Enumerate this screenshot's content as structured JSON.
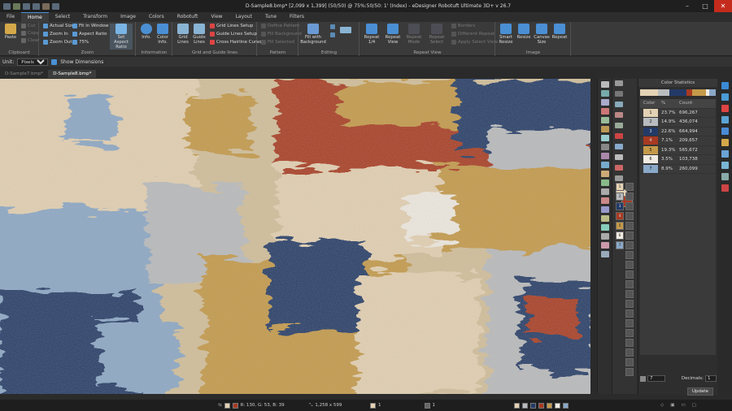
{
  "window": {
    "title": "D-Sample8.bmp* [2,099 x 1,399] (50/50) @ 75%:50/50: 1' (Index) - eDesigner Robotuft Ultimate 3D+ v 26.7",
    "min": "–",
    "max": "□",
    "close": "✕"
  },
  "menu": [
    "File",
    "Home",
    "Select",
    "Transform",
    "Image",
    "Colors",
    "Robotuft",
    "View",
    "Layout",
    "Tune",
    "Filters"
  ],
  "ribbon": {
    "clipboard": {
      "label": "Clipboard",
      "paste": "Paste",
      "cut": "Cut",
      "copy": "Copy",
      "clear": "Clear"
    },
    "zoom": {
      "label": "Zoom",
      "actual": "Actual Size",
      "zin": "Zoom In",
      "zout": "Zoom Out",
      "fit": "Fit in Window",
      "aspect": "Aspect Ratio",
      "pct": "75%",
      "set_aspect": "Set Aspect Ratio"
    },
    "information": {
      "label": "Information",
      "info": "Info.",
      "color_info": "Color Info."
    },
    "grid": {
      "label": "Grid and Guide lines",
      "grid_lines": "Grid Lines",
      "guide_lines": "Guide Lines",
      "grid_setup": "Grid Lines Setup",
      "guide_setup": "Guide Lines Setup",
      "cross": "Cross Hairline Cursor"
    },
    "pattern": {
      "label": "Pattern",
      "define": "Define Pattern",
      "fill_bg": "Fill Background",
      "fill_sel": "Fill Selected"
    },
    "editing": {
      "label": "Editing",
      "fill_with_bg": "Fill with Background"
    },
    "repeat_view": {
      "label": "Repeat View",
      "repeat14": "Repeat 1/4",
      "repeat_view": "Repeat View",
      "repeat_mode": "Repeat Mode",
      "repeat_select": "Repeat Select",
      "borders": "Borders",
      "diff_repeat": "Different Repeat",
      "apply_sel": "Apply Select View"
    },
    "image": {
      "label": "Image",
      "smart_resize": "Smart Resize",
      "resize": "Resize",
      "canvas": "Canvas Size",
      "repeat": "Repeat"
    }
  },
  "options": {
    "unit_label": "Unit:",
    "unit_value": "Pixels",
    "show_dimensions": "Show Dimensions"
  },
  "tabs": [
    "D-Sample7.bmp*",
    "D-Sample8.bmp*"
  ],
  "colors": {
    "c1": "#e4d2b4",
    "c2": "#b9bcbf",
    "c3": "#233a68",
    "c4": "#a83a22",
    "c5": "#c49a4a",
    "c6": "#f0ece4",
    "c7": "#8aa8c8"
  },
  "panel": {
    "title": "Color Statistics",
    "headers": [
      "Color",
      "%",
      "Count"
    ],
    "rows": [
      {
        "n": "1",
        "pct": "23.7%",
        "count": "696,267",
        "color": "#e4d2b4"
      },
      {
        "n": "2",
        "pct": "14.9%",
        "count": "436,074",
        "color": "#b9bcbf"
      },
      {
        "n": "3",
        "pct": "22.6%",
        "count": "664,994",
        "color": "#233a68"
      },
      {
        "n": "4",
        "pct": "7.1%",
        "count": "209,657",
        "color": "#a83a22"
      },
      {
        "n": "5",
        "pct": "19.3%",
        "count": "565,672",
        "color": "#c49a4a"
      },
      {
        "n": "6",
        "pct": "3.5%",
        "count": "103,738",
        "color": "#f0ece4"
      },
      {
        "n": "7",
        "pct": "8.9%",
        "count": "260,099",
        "color": "#8aa8c8"
      }
    ],
    "count_value": "7",
    "decimals_label": "Decimals:",
    "decimals_value": "1",
    "update": "Update"
  },
  "status": {
    "pixel": "R: 130, G: 53, B: 39",
    "size": "1,258 x 599",
    "ind1": "1",
    "ind2": "1"
  }
}
